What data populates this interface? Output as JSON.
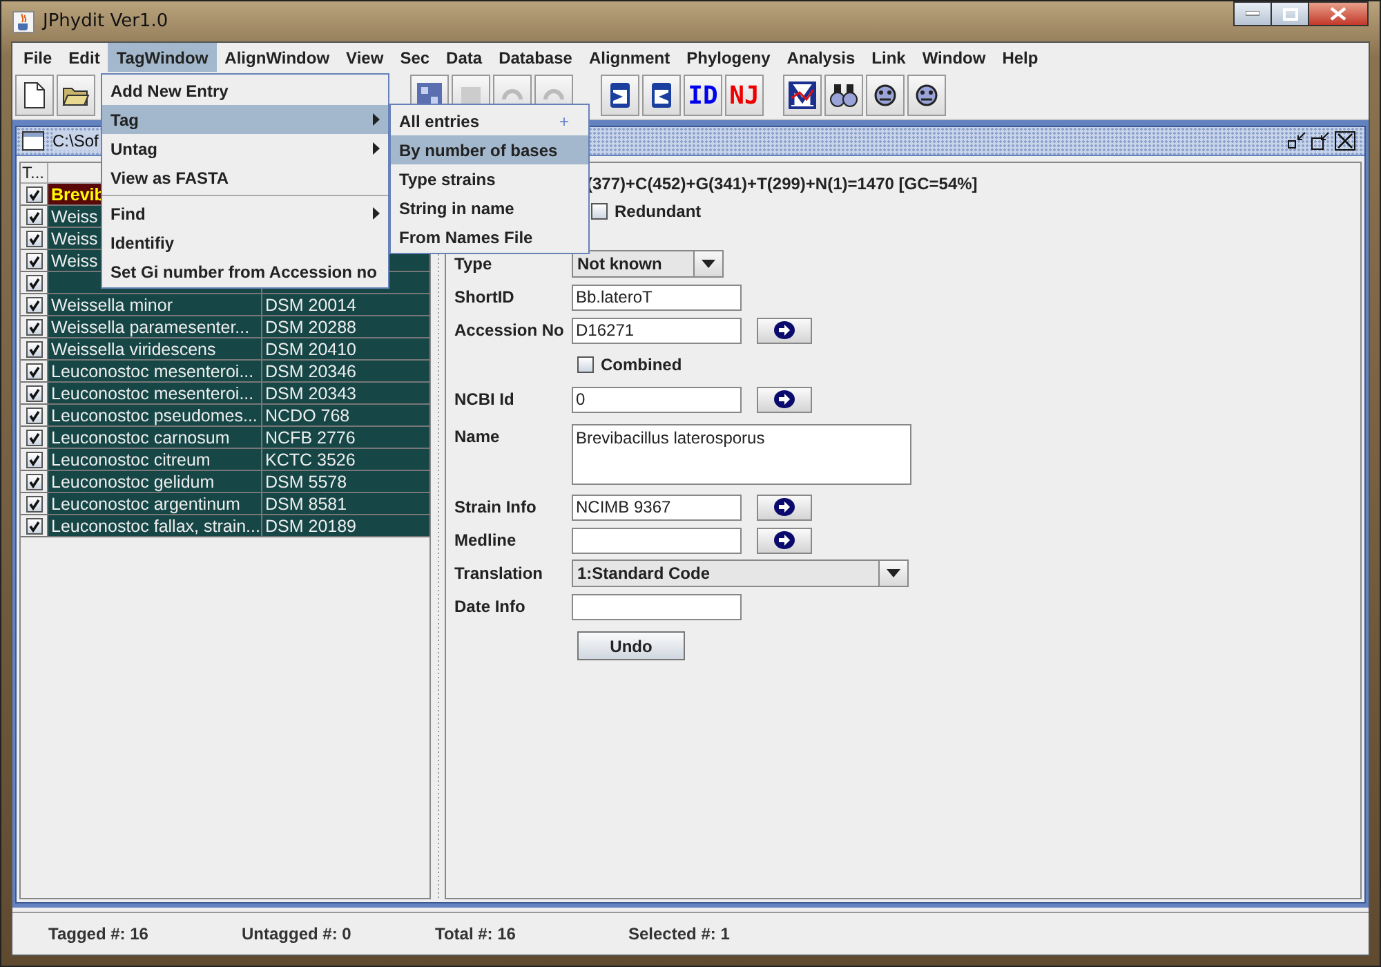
{
  "window": {
    "title": "JPhydit Ver1.0"
  },
  "menu_bar": [
    {
      "label": "File",
      "selected": false
    },
    {
      "label": "Edit",
      "selected": false
    },
    {
      "label": "TagWindow",
      "selected": true
    },
    {
      "label": "AlignWindow",
      "selected": false
    },
    {
      "label": "View",
      "selected": false
    },
    {
      "label": "Sec",
      "selected": false
    },
    {
      "label": "Data",
      "selected": false
    },
    {
      "label": "Database",
      "selected": false
    },
    {
      "label": "Alignment",
      "selected": false
    },
    {
      "label": "Phylogeny",
      "selected": false
    },
    {
      "label": "Analysis",
      "selected": false
    },
    {
      "label": "Link",
      "selected": false
    },
    {
      "label": "Window",
      "selected": false
    },
    {
      "label": "Help",
      "selected": false
    }
  ],
  "toolbar_text_buttons": [
    {
      "label": "ID",
      "color": "#0000ee"
    },
    {
      "label": "NJ",
      "color": "#ee0000"
    }
  ],
  "tag_menu": [
    {
      "kind": "item",
      "label": "Add New Entry",
      "selected": false,
      "submenu": false
    },
    {
      "kind": "item",
      "label": "Tag",
      "selected": true,
      "submenu": true
    },
    {
      "kind": "item",
      "label": "Untag",
      "selected": false,
      "submenu": true
    },
    {
      "kind": "item",
      "label": "View as FASTA",
      "selected": false,
      "submenu": false
    },
    {
      "kind": "separator"
    },
    {
      "kind": "item",
      "label": "Find",
      "selected": false,
      "submenu": true
    },
    {
      "kind": "item",
      "label": "Identifiy",
      "selected": false,
      "submenu": false
    },
    {
      "kind": "item",
      "label": "Set Gi number from Accession no",
      "selected": false,
      "submenu": false
    }
  ],
  "tag_submenu": [
    {
      "label": "All entries",
      "accelerator": "+",
      "selected": false
    },
    {
      "label": "By number of bases",
      "selected": true
    },
    {
      "label": "Type strains",
      "selected": false
    },
    {
      "label": "String in name",
      "selected": false
    },
    {
      "label": "From Names File",
      "selected": false
    }
  ],
  "document": {
    "title": "C:\\Sof"
  },
  "table": {
    "columns": [
      "T..."
    ],
    "rows": [
      {
        "checked": true,
        "selected": true,
        "name": "Brevib"
      },
      {
        "checked": true,
        "selected": false,
        "name": "Weiss"
      },
      {
        "checked": true,
        "selected": false,
        "name": "Weiss"
      },
      {
        "checked": true,
        "selected": false,
        "name": "Weiss"
      },
      {
        "checked": true,
        "selected": false
      },
      {
        "checked": true,
        "selected": false,
        "name": "Weissella minor",
        "strain": "DSM 20014"
      },
      {
        "checked": true,
        "selected": false,
        "name": "Weissella paramesenter...",
        "strain": "DSM 20288"
      },
      {
        "checked": true,
        "selected": false,
        "name": "Weissella viridescens",
        "strain": "DSM 20410"
      },
      {
        "checked": true,
        "selected": false,
        "name": "Leuconostoc mesenteroi...",
        "strain": "DSM 20346"
      },
      {
        "checked": true,
        "selected": false,
        "name": "Leuconostoc mesenteroi...",
        "strain": "DSM 20343"
      },
      {
        "checked": true,
        "selected": false,
        "name": "Leuconostoc pseudomes...",
        "strain": "NCDO 768"
      },
      {
        "checked": true,
        "selected": false,
        "name": "Leuconostoc carnosum",
        "strain": "NCFB 2776"
      },
      {
        "checked": true,
        "selected": false,
        "name": "Leuconostoc citreum",
        "strain": "KCTC 3526"
      },
      {
        "checked": true,
        "selected": false,
        "name": "Leuconostoc gelidum",
        "strain": "DSM 5578"
      },
      {
        "checked": true,
        "selected": false,
        "name": "Leuconostoc argentinum",
        "strain": "DSM 8581"
      },
      {
        "checked": true,
        "selected": false,
        "name": "Leuconostoc fallax, strain...",
        "strain": "DSM 20189"
      }
    ]
  },
  "sequence_summary": "(377)+C(452)+G(341)+T(299)+N(1)=1470  [GC=54%]",
  "redundant": {
    "label": "Redundant",
    "checked": false
  },
  "form": [
    {
      "kind": "combo",
      "label": "Type",
      "value": "Not known"
    },
    {
      "kind": "text",
      "label": "ShortID",
      "value": "Bb.lateroT",
      "go": false
    },
    {
      "kind": "text",
      "label": "Accession No",
      "value": "D16271",
      "go": true
    },
    {
      "kind": "checkbox",
      "label": "Combined",
      "checked": false
    },
    {
      "kind": "text",
      "label": "NCBI Id",
      "value": "0",
      "go": true
    },
    {
      "kind": "textarea",
      "label": "Name",
      "value": "Brevibacillus laterosporus"
    },
    {
      "kind": "text",
      "label": "Strain Info",
      "value": "NCIMB 9367",
      "go": true
    },
    {
      "kind": "text",
      "label": "Medline",
      "go": true
    },
    {
      "kind": "wide_combo",
      "label": "Translation",
      "value": "1:Standard Code"
    },
    {
      "kind": "text",
      "label": "Date Info",
      "go": false
    }
  ],
  "undo_button": "Undo",
  "status_bar": [
    "Tagged #: 16",
    "Untagged #: 0",
    "Total #: 16",
    "Selected #: 1"
  ]
}
